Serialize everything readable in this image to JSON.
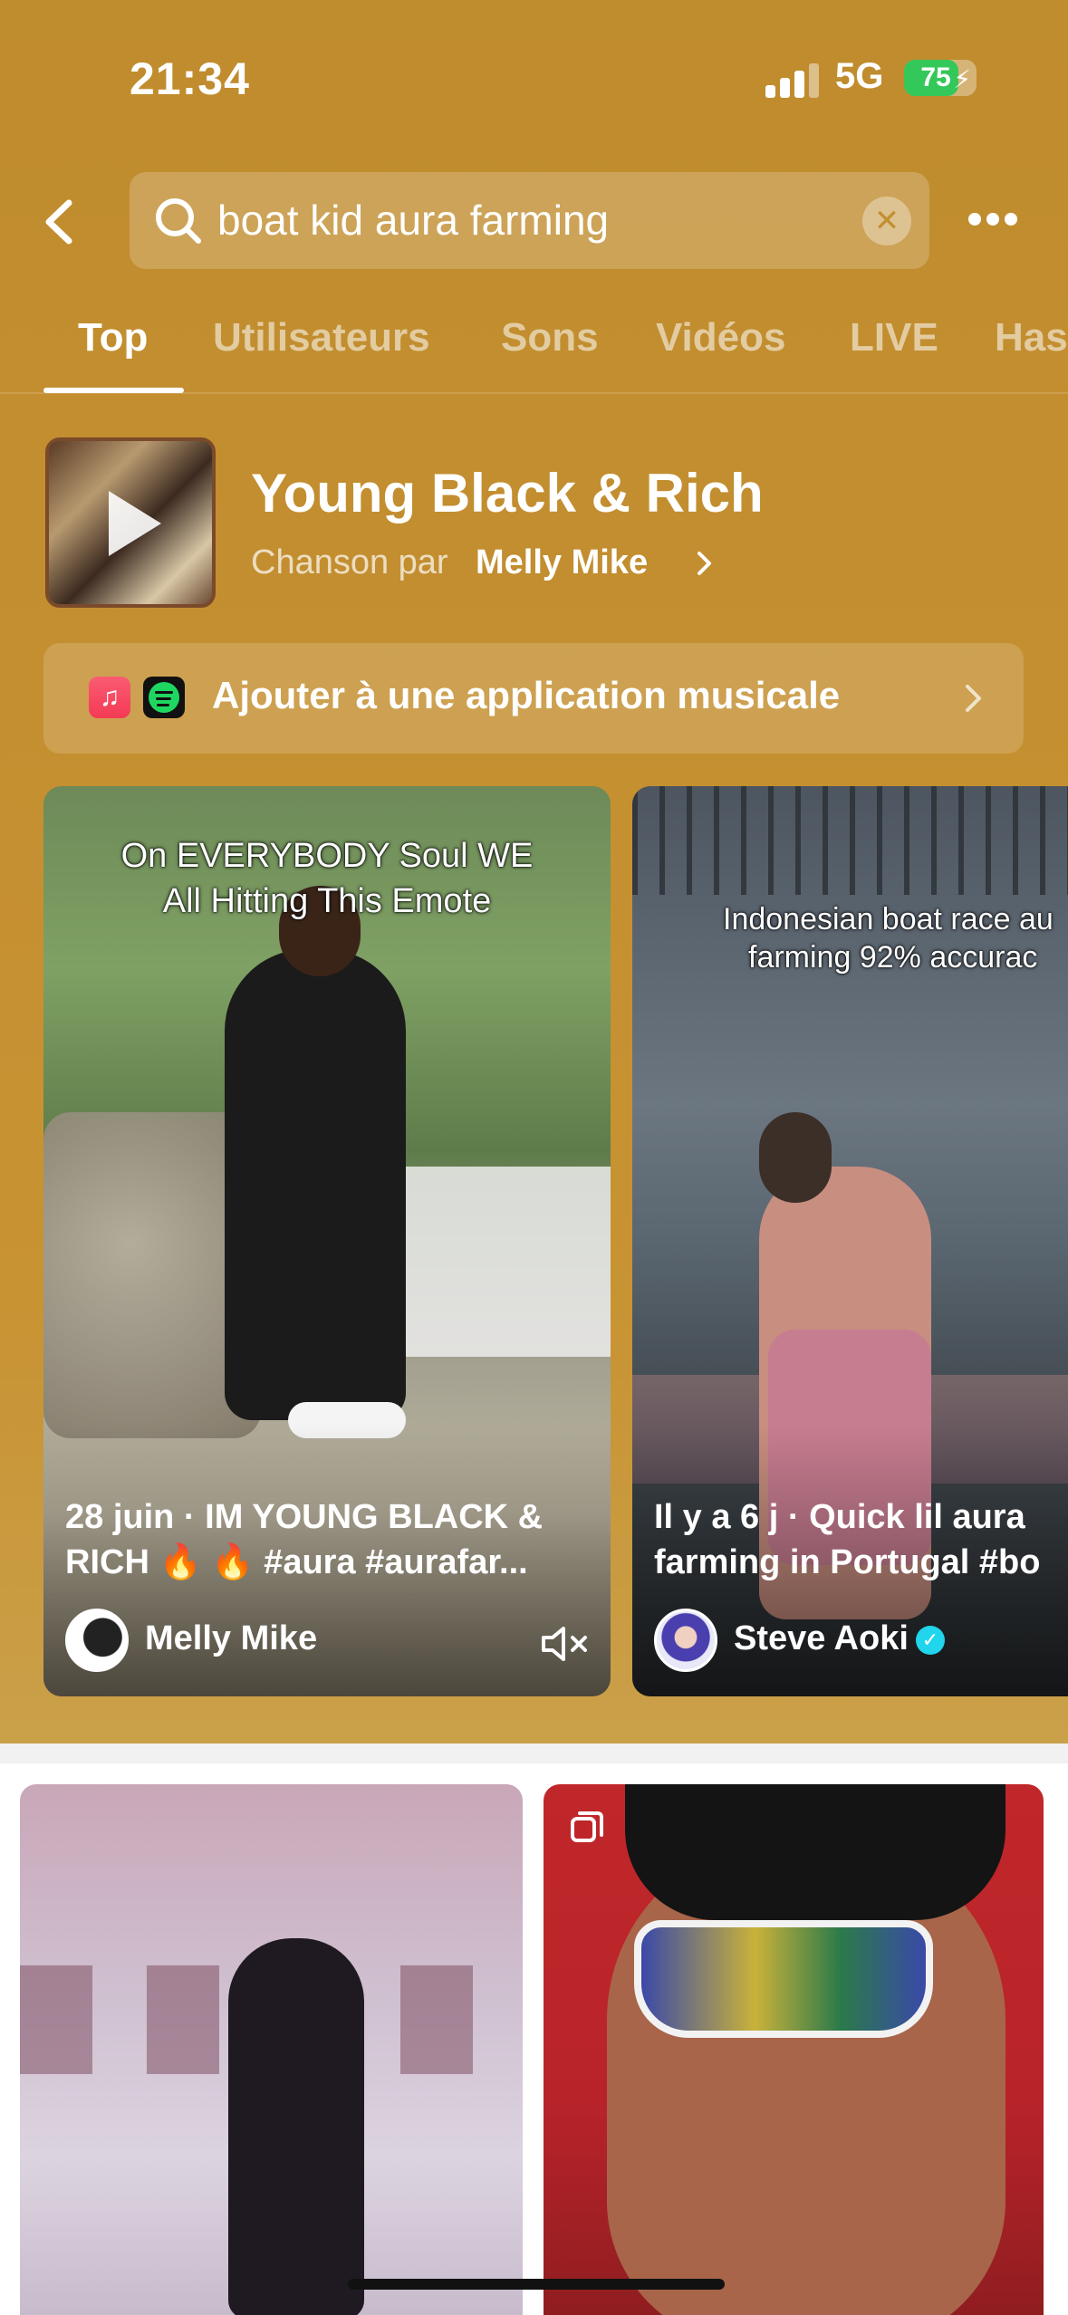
{
  "status_bar": {
    "time": "21:34",
    "network": "5G",
    "battery": "75"
  },
  "search": {
    "query": "boat kid aura farming"
  },
  "tabs": [
    {
      "label": "Top",
      "active": true
    },
    {
      "label": "Utilisateurs",
      "active": false
    },
    {
      "label": "Sons",
      "active": false
    },
    {
      "label": "Vidéos",
      "active": false
    },
    {
      "label": "LIVE",
      "active": false
    },
    {
      "label": "Has",
      "active": false
    }
  ],
  "song": {
    "title": "Young Black & Rich",
    "subtitle_prefix": "Chanson par",
    "artist": "Melly  Mike"
  },
  "music_app": {
    "label": "Ajouter à une application musicale"
  },
  "videos": [
    {
      "overlay_text_line1": "On EVERYBODY Soul WE",
      "overlay_text_line2": "All Hitting This Emote",
      "caption_line1": "28 juin · IM YOUNG BLACK &",
      "caption_line2": "RICH 🔥 🔥 #aura #aurafar...",
      "username": "Melly  Mike"
    },
    {
      "overlay_text_line1": "Indonesian boat race au",
      "overlay_text_line2": "farming 92% accurac",
      "caption_line1": "Il y a 6 j · Quick lil aura",
      "caption_line2": "farming in Portugal  #bo",
      "username": "Steve Aoki",
      "verified": true
    }
  ],
  "colors": {
    "header_bg": "#c48f30",
    "battery_green": "#34c759",
    "verified_blue": "#20d5ec"
  }
}
